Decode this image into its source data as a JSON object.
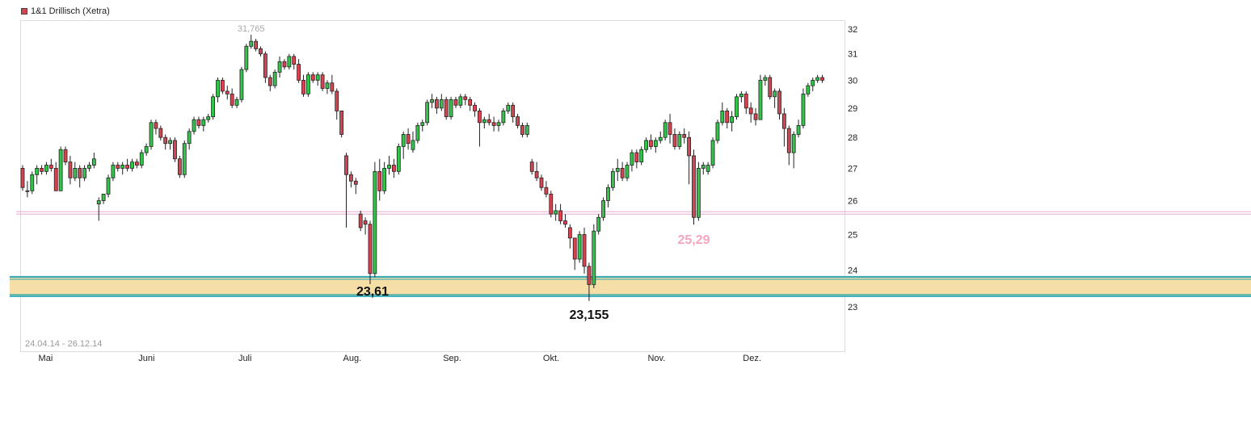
{
  "legend": {
    "label": "1&1 Drillisch (Xetra)",
    "color": "#d9424f"
  },
  "date_range": "24.04.14 - 26.12.14",
  "chart_data": {
    "type": "candlestick",
    "title": "1&1 Drillisch (Xetra)",
    "ylim": [
      22.0,
      32.4
    ],
    "y_ticks": [
      23,
      24,
      25,
      26,
      27,
      28,
      29,
      30,
      31,
      32
    ],
    "x_labels": [
      "Mai",
      "Juni",
      "Juli",
      "Aug.",
      "Sep.",
      "Okt.",
      "Nov.",
      "Dez."
    ],
    "x_label_index": [
      4,
      25,
      46,
      68,
      89,
      110,
      132,
      152
    ],
    "series": [
      {
        "name": "1&1 Drillisch (Xetra)",
        "colors": {
          "up": "#33c44a",
          "down": "#d9424f"
        },
        "ohlc": [
          [
            27.0,
            27.1,
            26.3,
            26.4
          ],
          [
            26.3,
            26.6,
            26.1,
            26.3
          ],
          [
            26.3,
            26.9,
            26.2,
            26.8
          ],
          [
            26.8,
            27.1,
            26.5,
            27.0
          ],
          [
            27.0,
            27.1,
            26.8,
            26.9
          ],
          [
            26.9,
            27.2,
            26.8,
            27.1
          ],
          [
            27.1,
            27.3,
            26.9,
            27.0
          ],
          [
            27.0,
            27.2,
            26.3,
            26.3
          ],
          [
            26.3,
            27.7,
            26.3,
            27.6
          ],
          [
            27.6,
            27.7,
            27.1,
            27.2
          ],
          [
            27.2,
            27.4,
            26.5,
            26.7
          ],
          [
            26.7,
            27.2,
            26.6,
            27.0
          ],
          [
            27.0,
            27.1,
            26.4,
            26.7
          ],
          [
            26.7,
            27.1,
            26.6,
            27.0
          ],
          [
            27.0,
            27.2,
            26.9,
            27.1
          ],
          [
            27.1,
            27.5,
            27.0,
            27.3
          ],
          [
            25.9,
            26.1,
            25.4,
            26.0
          ],
          [
            26.0,
            26.2,
            25.9,
            26.2
          ],
          [
            26.2,
            26.8,
            26.1,
            26.7
          ],
          [
            26.7,
            27.2,
            26.6,
            27.1
          ],
          [
            27.1,
            27.2,
            26.9,
            27.0
          ],
          [
            27.0,
            27.2,
            26.8,
            27.1
          ],
          [
            27.1,
            27.3,
            26.9,
            27.0
          ],
          [
            27.0,
            27.3,
            26.9,
            27.2
          ],
          [
            27.2,
            27.3,
            27.0,
            27.1
          ],
          [
            27.1,
            27.6,
            27.0,
            27.5
          ],
          [
            27.5,
            27.8,
            27.4,
            27.7
          ],
          [
            27.7,
            28.6,
            27.6,
            28.5
          ],
          [
            28.5,
            28.6,
            28.1,
            28.3
          ],
          [
            28.3,
            28.4,
            27.9,
            28.0
          ],
          [
            28.0,
            28.1,
            27.6,
            27.8
          ],
          [
            27.8,
            28.0,
            27.6,
            27.9
          ],
          [
            27.9,
            28.0,
            27.2,
            27.3
          ],
          [
            27.3,
            27.4,
            26.7,
            26.8
          ],
          [
            26.8,
            27.9,
            26.7,
            27.8
          ],
          [
            27.8,
            28.3,
            27.6,
            28.2
          ],
          [
            28.2,
            28.7,
            28.1,
            28.6
          ],
          [
            28.6,
            28.7,
            28.3,
            28.4
          ],
          [
            28.4,
            28.7,
            28.2,
            28.6
          ],
          [
            28.6,
            28.8,
            28.5,
            28.7
          ],
          [
            28.7,
            29.5,
            28.6,
            29.4
          ],
          [
            29.4,
            30.1,
            29.2,
            30.0
          ],
          [
            30.0,
            30.1,
            29.5,
            29.6
          ],
          [
            29.6,
            29.8,
            29.3,
            29.5
          ],
          [
            29.5,
            29.7,
            29.0,
            29.1
          ],
          [
            29.1,
            29.4,
            29.0,
            29.3
          ],
          [
            29.3,
            30.5,
            29.2,
            30.4
          ],
          [
            30.4,
            31.4,
            30.3,
            31.3
          ],
          [
            31.3,
            31.765,
            31.2,
            31.5
          ],
          [
            31.5,
            31.6,
            31.1,
            31.2
          ],
          [
            31.2,
            31.3,
            30.9,
            31.0
          ],
          [
            31.0,
            31.1,
            29.9,
            30.1
          ],
          [
            30.1,
            30.2,
            29.6,
            29.8
          ],
          [
            29.8,
            30.4,
            29.7,
            30.3
          ],
          [
            30.3,
            30.9,
            30.1,
            30.7
          ],
          [
            30.7,
            30.8,
            30.4,
            30.5
          ],
          [
            30.5,
            31.0,
            30.4,
            30.9
          ],
          [
            30.9,
            31.0,
            30.4,
            30.6
          ],
          [
            30.6,
            30.8,
            29.9,
            30.0
          ],
          [
            30.0,
            30.2,
            29.4,
            29.5
          ],
          [
            29.5,
            30.3,
            29.4,
            30.2
          ],
          [
            30.2,
            30.3,
            29.9,
            30.0
          ],
          [
            30.0,
            30.3,
            29.8,
            30.2
          ],
          [
            30.2,
            30.3,
            29.6,
            29.7
          ],
          [
            29.7,
            30.0,
            29.5,
            29.9
          ],
          [
            29.9,
            30.2,
            29.5,
            29.6
          ],
          [
            29.6,
            29.7,
            28.6,
            28.9
          ],
          [
            28.9,
            28.9,
            28.0,
            28.1
          ],
          [
            27.4,
            27.5,
            25.2,
            26.8
          ],
          [
            26.8,
            26.9,
            26.4,
            26.6
          ],
          [
            26.6,
            26.7,
            26.2,
            26.5
          ],
          [
            25.6,
            25.7,
            25.1,
            25.2
          ],
          [
            25.4,
            25.5,
            25.0,
            25.3
          ],
          [
            25.3,
            25.4,
            23.61,
            23.9
          ],
          [
            23.9,
            27.2,
            23.8,
            26.9
          ],
          [
            26.9,
            27.3,
            26.0,
            26.3
          ],
          [
            26.3,
            27.2,
            26.2,
            27.0
          ],
          [
            27.0,
            27.4,
            26.8,
            27.1
          ],
          [
            27.1,
            27.3,
            26.7,
            26.9
          ],
          [
            26.9,
            27.8,
            26.8,
            27.7
          ],
          [
            27.7,
            28.2,
            27.3,
            28.1
          ],
          [
            28.1,
            28.3,
            27.6,
            27.8
          ],
          [
            27.6,
            28.2,
            27.5,
            27.9
          ],
          [
            27.9,
            28.5,
            27.8,
            28.4
          ],
          [
            28.4,
            28.6,
            28.2,
            28.5
          ],
          [
            28.5,
            29.3,
            28.4,
            29.2
          ],
          [
            29.2,
            29.5,
            29.0,
            29.3
          ],
          [
            29.3,
            29.4,
            28.8,
            29.0
          ],
          [
            29.0,
            29.5,
            28.9,
            29.3
          ],
          [
            29.3,
            29.4,
            28.6,
            28.7
          ],
          [
            28.7,
            29.4,
            28.6,
            29.3
          ],
          [
            29.3,
            29.4,
            29.0,
            29.1
          ],
          [
            29.1,
            29.5,
            29.0,
            29.4
          ],
          [
            29.4,
            29.5,
            29.1,
            29.3
          ],
          [
            29.3,
            29.4,
            28.9,
            29.1
          ],
          [
            29.1,
            29.2,
            28.7,
            28.9
          ],
          [
            28.9,
            29.0,
            27.7,
            28.5
          ],
          [
            28.5,
            28.7,
            28.3,
            28.6
          ],
          [
            28.6,
            28.8,
            28.4,
            28.5
          ],
          [
            28.5,
            28.7,
            28.2,
            28.4
          ],
          [
            28.4,
            28.6,
            28.2,
            28.5
          ],
          [
            28.5,
            29.0,
            28.4,
            28.9
          ],
          [
            28.9,
            29.2,
            28.8,
            29.1
          ],
          [
            29.1,
            29.2,
            28.5,
            28.7
          ],
          [
            28.7,
            28.8,
            28.3,
            28.4
          ],
          [
            28.4,
            28.5,
            28.0,
            28.1
          ],
          [
            28.1,
            28.5,
            28.0,
            28.4
          ],
          [
            27.2,
            27.3,
            26.8,
            26.9
          ],
          [
            26.9,
            27.2,
            26.6,
            26.7
          ],
          [
            26.7,
            26.8,
            26.3,
            26.4
          ],
          [
            26.4,
            26.6,
            26.1,
            26.2
          ],
          [
            26.2,
            26.3,
            25.5,
            25.6
          ],
          [
            25.6,
            25.9,
            25.4,
            25.7
          ],
          [
            25.7,
            25.9,
            25.3,
            25.4
          ],
          [
            25.4,
            25.6,
            25.2,
            25.3
          ],
          [
            25.2,
            25.3,
            24.6,
            24.9
          ],
          [
            24.9,
            24.9,
            24.0,
            24.3
          ],
          [
            24.3,
            25.1,
            24.2,
            25.0
          ],
          [
            25.0,
            25.2,
            23.9,
            24.1
          ],
          [
            24.1,
            24.2,
            23.155,
            23.6
          ],
          [
            23.6,
            25.3,
            23.5,
            25.1
          ],
          [
            25.1,
            25.6,
            25.0,
            25.5
          ],
          [
            25.5,
            26.1,
            25.4,
            26.0
          ],
          [
            26.0,
            26.5,
            25.8,
            26.4
          ],
          [
            26.4,
            27.0,
            26.3,
            26.9
          ],
          [
            26.9,
            27.3,
            26.6,
            27.0
          ],
          [
            27.0,
            27.2,
            26.6,
            26.7
          ],
          [
            26.7,
            27.2,
            26.6,
            27.1
          ],
          [
            27.1,
            27.6,
            26.9,
            27.5
          ],
          [
            27.5,
            27.6,
            27.0,
            27.2
          ],
          [
            27.2,
            27.7,
            27.1,
            27.6
          ],
          [
            27.6,
            28.0,
            27.5,
            27.9
          ],
          [
            27.9,
            28.1,
            27.6,
            27.7
          ],
          [
            27.7,
            28.0,
            27.5,
            27.9
          ],
          [
            27.9,
            28.2,
            27.8,
            28.0
          ],
          [
            28.0,
            28.6,
            27.9,
            28.5
          ],
          [
            28.5,
            28.8,
            27.8,
            28.1
          ],
          [
            28.1,
            28.3,
            27.6,
            27.7
          ],
          [
            27.7,
            28.2,
            27.6,
            28.1
          ],
          [
            28.1,
            28.3,
            27.8,
            28.0
          ],
          [
            28.0,
            28.2,
            26.5,
            27.4
          ],
          [
            27.4,
            27.6,
            25.29,
            25.5
          ],
          [
            25.5,
            27.2,
            25.4,
            27.0
          ],
          [
            27.0,
            27.2,
            26.8,
            27.1
          ],
          [
            26.9,
            27.2,
            26.8,
            27.1
          ],
          [
            27.1,
            28.0,
            27.0,
            27.9
          ],
          [
            27.9,
            28.6,
            27.8,
            28.5
          ],
          [
            28.5,
            29.2,
            28.4,
            28.9
          ],
          [
            28.9,
            29.0,
            28.3,
            28.5
          ],
          [
            28.5,
            28.9,
            28.2,
            28.7
          ],
          [
            28.7,
            29.5,
            28.6,
            29.4
          ],
          [
            29.4,
            29.6,
            29.2,
            29.5
          ],
          [
            29.5,
            29.6,
            28.8,
            29.0
          ],
          [
            29.0,
            29.2,
            28.5,
            28.8
          ],
          [
            28.8,
            29.0,
            28.4,
            28.6
          ],
          [
            28.6,
            30.2,
            28.6,
            30.0
          ],
          [
            30.0,
            30.2,
            29.8,
            30.1
          ],
          [
            30.1,
            30.2,
            29.3,
            29.4
          ],
          [
            29.4,
            29.7,
            29.0,
            29.6
          ],
          [
            29.6,
            29.7,
            28.6,
            28.8
          ],
          [
            28.8,
            29.0,
            27.7,
            28.3
          ],
          [
            28.3,
            28.4,
            27.1,
            27.5
          ],
          [
            27.5,
            28.2,
            27.0,
            28.1
          ],
          [
            28.1,
            28.6,
            28.0,
            28.4
          ],
          [
            28.4,
            29.7,
            28.3,
            29.5
          ],
          [
            29.5,
            29.9,
            29.4,
            29.8
          ],
          [
            29.8,
            30.1,
            29.6,
            30.0
          ],
          [
            30.0,
            30.2,
            29.9,
            30.1
          ],
          [
            30.1,
            30.2,
            29.9,
            30.0
          ]
        ]
      }
    ],
    "annotations": [
      {
        "label": "31,765",
        "index": 48,
        "value": 31.765,
        "color": "#a9a9a9"
      },
      {
        "label": "23,61",
        "index": 73,
        "value": 23.61,
        "color": "#111111"
      },
      {
        "label": "23,155",
        "index": 119,
        "value": 23.155,
        "color": "#111111"
      },
      {
        "label": "25,29",
        "index": 141,
        "value": 25.29,
        "color": "#f4a6bd"
      }
    ],
    "support_zone": {
      "low": 23.155,
      "high": 23.61,
      "fill": "#f5dfa6",
      "line": "#27a5b3"
    },
    "resistance_band": {
      "low": 25.29,
      "high": 25.38,
      "line": "#e7a9cf"
    }
  }
}
